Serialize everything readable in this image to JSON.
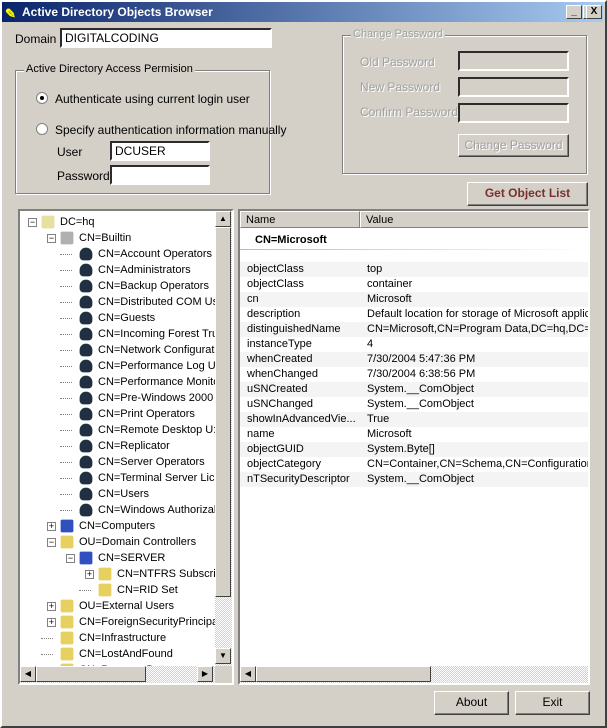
{
  "window": {
    "title": "Active Directory Objects Browser",
    "minimize": "_",
    "maximize": "□",
    "close": "X"
  },
  "domain": {
    "label": "Domain",
    "value": "DIGITALCODING"
  },
  "access": {
    "legend": "Active Directory Access Permision",
    "option1": "Authenticate using current login user",
    "option2": "Specify authentication information manually",
    "selected": 1,
    "user_label": "User",
    "user_value": "DCUSER",
    "password_label": "Password",
    "password_value": ""
  },
  "change_password": {
    "legend": "Change Password",
    "old_label": "Old Password",
    "new_label": "New Password",
    "confirm_label": "Confirm Password",
    "button": "Change Password"
  },
  "get_list_button": "Get Object List",
  "tree": {
    "nodes": [
      {
        "label": "DC=hq",
        "level": 0,
        "expander": "-",
        "icon": "domain-icon"
      },
      {
        "label": "CN=Builtin",
        "level": 1,
        "expander": "-",
        "icon": "builtin-container-icon"
      },
      {
        "label": "CN=Account Operators",
        "level": 2,
        "icon": "group-icon"
      },
      {
        "label": "CN=Administrators",
        "level": 2,
        "icon": "group-icon"
      },
      {
        "label": "CN=Backup Operators",
        "level": 2,
        "icon": "group-icon"
      },
      {
        "label": "CN=Distributed COM Us",
        "level": 2,
        "icon": "group-icon"
      },
      {
        "label": "CN=Guests",
        "level": 2,
        "icon": "group-icon"
      },
      {
        "label": "CN=Incoming Forest Tru",
        "level": 2,
        "icon": "group-icon"
      },
      {
        "label": "CN=Network Configurati",
        "level": 2,
        "icon": "group-icon"
      },
      {
        "label": "CN=Performance Log U",
        "level": 2,
        "icon": "group-icon"
      },
      {
        "label": "CN=Performance Monito",
        "level": 2,
        "icon": "group-icon"
      },
      {
        "label": "CN=Pre-Windows 2000",
        "level": 2,
        "icon": "group-icon"
      },
      {
        "label": "CN=Print Operators",
        "level": 2,
        "icon": "group-icon"
      },
      {
        "label": "CN=Remote Desktop U:",
        "level": 2,
        "icon": "group-icon"
      },
      {
        "label": "CN=Replicator",
        "level": 2,
        "icon": "group-icon"
      },
      {
        "label": "CN=Server Operators",
        "level": 2,
        "icon": "group-icon"
      },
      {
        "label": "CN=Terminal Server Lic",
        "level": 2,
        "icon": "group-icon"
      },
      {
        "label": "CN=Users",
        "level": 2,
        "icon": "group-icon"
      },
      {
        "label": "CN=Windows Authorizal",
        "level": 2,
        "icon": "group-icon"
      },
      {
        "label": "CN=Computers",
        "level": 1,
        "expander": "+",
        "icon": "computer-icon"
      },
      {
        "label": "OU=Domain Controllers",
        "level": 1,
        "expander": "-",
        "icon": "folder-icon"
      },
      {
        "label": "CN=SERVER",
        "level": 2,
        "expander": "-",
        "icon": "computer-icon"
      },
      {
        "label": "CN=NTFRS Subscri",
        "level": 3,
        "expander": "+",
        "icon": "folder-icon"
      },
      {
        "label": "CN=RID Set",
        "level": 3,
        "icon": "folder-icon"
      },
      {
        "label": "OU=External Users",
        "level": 1,
        "expander": "+",
        "icon": "folder-icon"
      },
      {
        "label": "CN=ForeignSecurityPrincipa",
        "level": 1,
        "expander": "+",
        "icon": "folder-icon"
      },
      {
        "label": "CN=Infrastructure",
        "level": 1,
        "icon": "folder-icon"
      },
      {
        "label": "CN=LostAndFound",
        "level": 1,
        "icon": "folder-icon"
      },
      {
        "label": "CN=Program Data",
        "level": 1,
        "expander": "+",
        "icon": "folder-icon"
      }
    ]
  },
  "properties": {
    "col_name": "Name",
    "col_value": "Value",
    "group": "CN=Microsoft",
    "rows": [
      [
        "objectClass",
        "top"
      ],
      [
        "objectClass",
        "container"
      ],
      [
        "cn",
        "Microsoft"
      ],
      [
        "description",
        "Default location for storage of Microsoft applica"
      ],
      [
        "distinguishedName",
        "CN=Microsoft,CN=Program Data,DC=hq,DC=re"
      ],
      [
        "instanceType",
        "4"
      ],
      [
        "whenCreated",
        "7/30/2004 5:47:36 PM"
      ],
      [
        "whenChanged",
        "7/30/2004 6:38:56 PM"
      ],
      [
        "uSNCreated",
        "System.__ComObject"
      ],
      [
        "uSNChanged",
        "System.__ComObject"
      ],
      [
        "showInAdvancedVie...",
        "True"
      ],
      [
        "name",
        "Microsoft"
      ],
      [
        "objectGUID",
        "System.Byte[]"
      ],
      [
        "objectCategory",
        "CN=Container,CN=Schema,CN=Configuration,"
      ],
      [
        "nTSecurityDescriptor",
        "System.__ComObject"
      ]
    ]
  },
  "about_button": "About",
  "exit_button": "Exit"
}
